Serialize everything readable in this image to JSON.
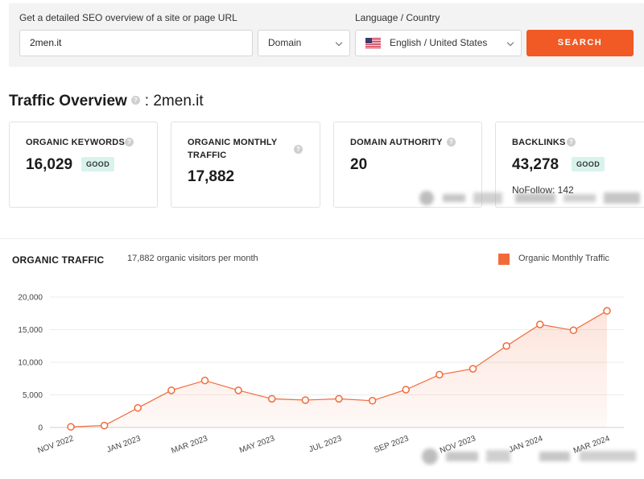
{
  "search": {
    "url_label": "Get a detailed SEO overview of a site or page URL",
    "url_value": "2men.it",
    "scope_value": "Domain",
    "lang_label": "Language / Country",
    "lang_value": "English / United States",
    "button_label": "SEARCH"
  },
  "overview": {
    "title": "Traffic Overview",
    "domain": ": 2men.it"
  },
  "cards": {
    "keywords": {
      "name": "ORGANIC KEYWORDS",
      "value": "16,029",
      "badge": "GOOD"
    },
    "traffic": {
      "name_line1": "ORGANIC MONTHLY",
      "name_line2": "TRAFFIC",
      "value": "17,882"
    },
    "authority": {
      "name": "DOMAIN AUTHORITY",
      "value": "20"
    },
    "backlinks": {
      "name": "BACKLINKS",
      "value": "43,278",
      "badge": "GOOD",
      "nofollow": "NoFollow: 142"
    }
  },
  "chart_panel": {
    "title": "ORGANIC TRAFFIC",
    "subtitle": "17,882 organic visitors per month",
    "legend": "Organic Monthly Traffic"
  },
  "colors": {
    "accent": "#f15a24",
    "line": "#f26a3a",
    "badge_bg": "#d8f3eb"
  },
  "chart_data": {
    "type": "area",
    "title": "",
    "xlabel": "",
    "ylabel": "",
    "ylim": [
      0,
      20000
    ],
    "yticks": [
      "0",
      "5,000",
      "10,000",
      "15,000",
      "20,000"
    ],
    "xtick_labels": [
      "NOV 2022",
      "JAN 2023",
      "MAR 2023",
      "MAY 2023",
      "JUL 2023",
      "SEP 2023",
      "NOV 2023",
      "JAN 2024",
      "MAR 2024"
    ],
    "x": [
      "NOV 2022",
      "DEC 2022",
      "JAN 2023",
      "FEB 2023",
      "MAR 2023",
      "APR 2023",
      "MAY 2023",
      "JUN 2023",
      "JUL 2023",
      "AUG 2023",
      "SEP 2023",
      "OCT 2023",
      "NOV 2023",
      "DEC 2023",
      "JAN 2024",
      "FEB 2024",
      "MAR 2024"
    ],
    "series": [
      {
        "name": "Organic Monthly Traffic",
        "values": [
          100,
          300,
          3000,
          5700,
          7200,
          5700,
          4400,
          4200,
          4400,
          4100,
          5800,
          8100,
          9000,
          12500,
          15800,
          14900,
          17882
        ]
      }
    ],
    "grid": true,
    "legend": "top-right"
  }
}
